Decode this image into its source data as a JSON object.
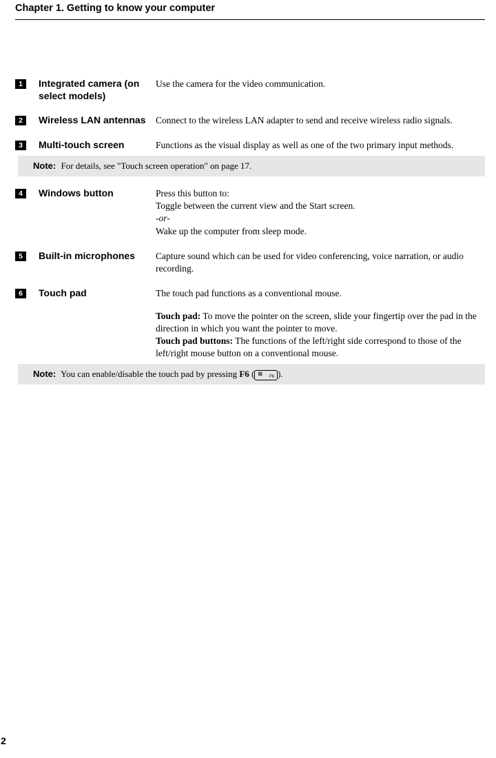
{
  "chapter_title": "Chapter 1. Getting to know your computer",
  "items": [
    {
      "n": "1",
      "term": "Integrated camera (on select models)",
      "desc": {
        "text": "Use the camera for the video communication."
      }
    },
    {
      "n": "2",
      "term": "Wireless LAN antennas",
      "desc": {
        "text": "Connect to the wireless LAN adapter to send and receive wireless radio signals."
      }
    },
    {
      "n": "3",
      "term": "Multi-touch screen",
      "desc": {
        "text": "Functions as the visual display as well as one of the two primary input methods."
      }
    }
  ],
  "note1": {
    "label": "Note:",
    "text": "For details, see \"Touch screen operation\" on page 17."
  },
  "items2": [
    {
      "n": "4",
      "term": "Windows button",
      "desc": {
        "line1": "Press this button to:",
        "line2": "Toggle between the current view and the Start screen.",
        "or": "-or-",
        "line3": "Wake up the computer from sleep mode."
      }
    },
    {
      "n": "5",
      "term": "Built-in microphones",
      "desc": {
        "text": "Capture sound which can be used for video conferencing, voice narration, or audio recording."
      }
    },
    {
      "n": "6",
      "term": "Touch pad",
      "desc": {
        "lead": "The touch pad functions as a conventional mouse.",
        "p1_label": "Touch pad:",
        "p1_text": " To move the pointer on the screen, slide your fingertip over the pad in the direction in which you want the pointer to move.",
        "p2_label": "Touch pad buttons:",
        "p2_text": " The functions of the left/right side correspond to those of the left/right mouse button on a conventional mouse."
      }
    }
  ],
  "note2": {
    "label": "Note:",
    "pre": "You can enable/disable the touch pad by pressing ",
    "key": "F6",
    "open": " (",
    "f6_icon": "⊠",
    "f6_label": "F6",
    "close": ")."
  },
  "page_number": "2"
}
